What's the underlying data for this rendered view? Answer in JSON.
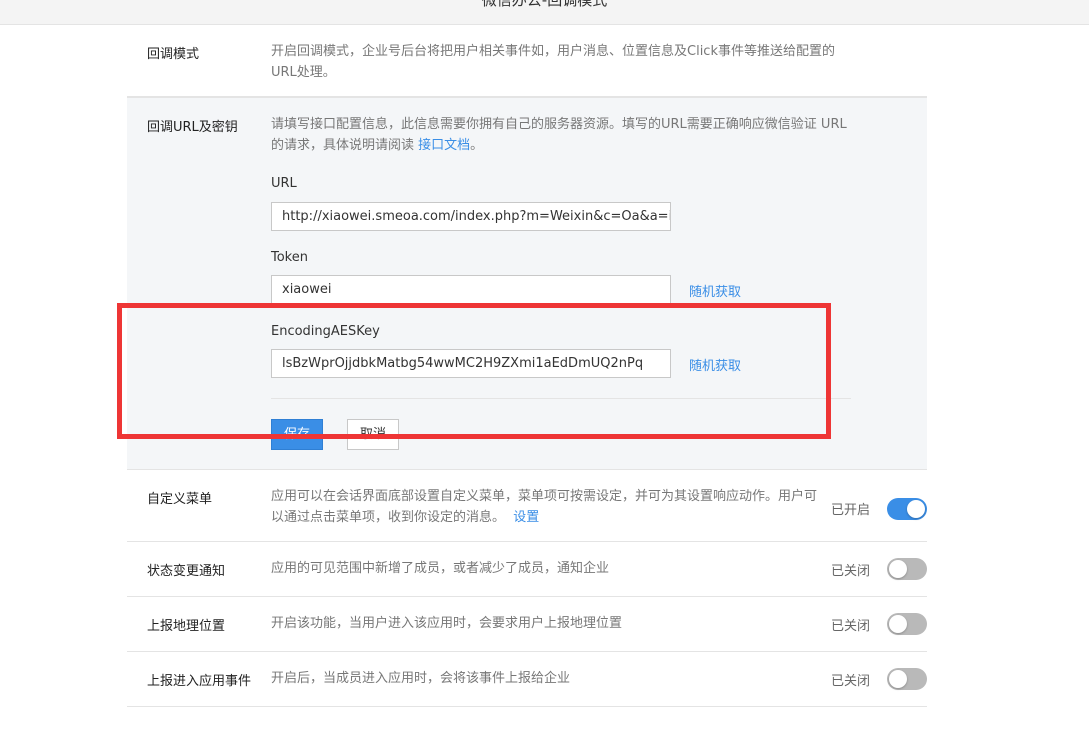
{
  "header": {
    "title": "微信办公-回调模式"
  },
  "callback_mode": {
    "label": "回调模式",
    "description": "开启回调模式，企业号后台将把用户相关事件如，用户消息、位置信息及Click事件等推送给配置的URL处理。"
  },
  "callback_url": {
    "label": "回调URL及密钥",
    "description_before": "请填写接口配置信息，此信息需要你拥有自己的服务器资源。填写的URL需要正确响应微信验证 URL的请求，具体说明请阅读 ",
    "doc_link": "接口文档",
    "description_after": "。",
    "url_label": "URL",
    "url_value": "http://xiaowei.smeoa.com/index.php?m=Weixin&c=Oa&a=index",
    "token_label": "Token",
    "token_value": "xiaowei",
    "token_random": "随机获取",
    "aes_label": "EncodingAESKey",
    "aes_value": "lsBzWprOjjdbkMatbg54wwMC2H9ZXmi1aEdDmUQ2nPq",
    "aes_random": "随机获取",
    "save_label": "保存",
    "cancel_label": "取消"
  },
  "features": {
    "menu": {
      "label": "自定义菜单",
      "description": "应用可以在会话界面底部设置自定义菜单，菜单项可按需设定，并可为其设置响应动作。用户可以通过点击菜单项，收到你设定的消息。",
      "link": "设置",
      "status": "已开启",
      "enabled": true
    },
    "change": {
      "label": "状态变更通知",
      "description": "应用的可见范围中新增了成员，或者减少了成员，通知企业",
      "status": "已关闭",
      "enabled": false
    },
    "location": {
      "label": "上报地理位置",
      "description": "开启该功能，当用户进入该应用时，会要求用户上报地理位置",
      "status": "已关闭",
      "enabled": false
    },
    "enter": {
      "label": "上报进入应用事件",
      "description": "开启后，当成员进入应用时，会将该事件上报给企业",
      "status": "已关闭",
      "enabled": false
    }
  },
  "colors": {
    "accent": "#3a8ee6",
    "highlight": "#ee3535",
    "toggle_off": "#b9b9b9"
  }
}
